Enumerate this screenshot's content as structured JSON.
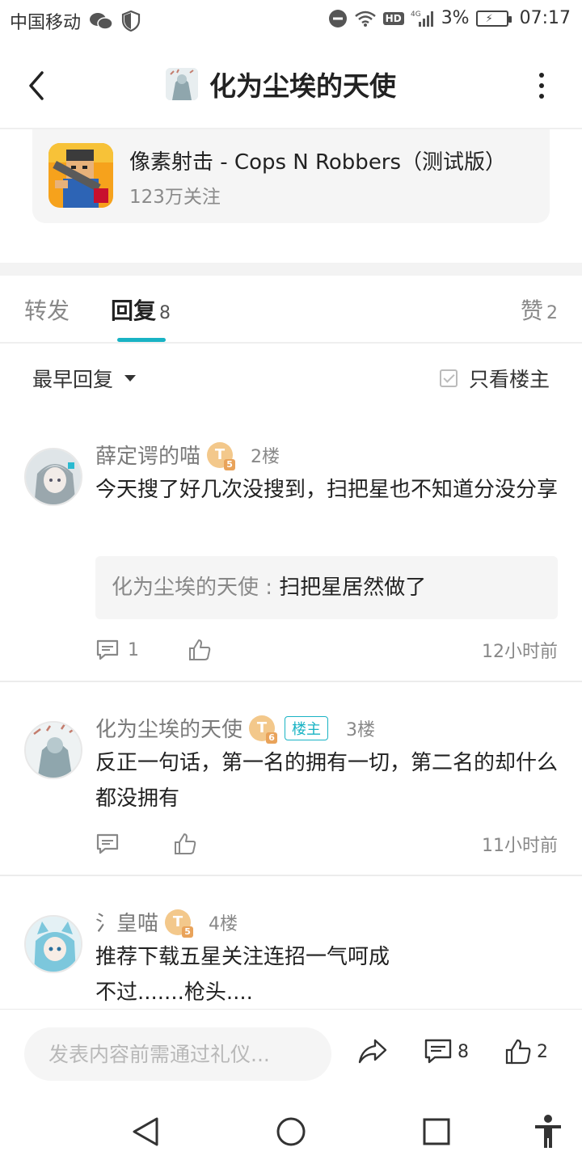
{
  "status_bar": {
    "carrier": "中国移动",
    "network": "4G",
    "hd": "HD",
    "battery": "3%",
    "time": "07:17"
  },
  "header": {
    "title": "化为尘埃的天使"
  },
  "game_card": {
    "name": "像素射击 - Cops N Robbers（测试版）",
    "followers": "123万关注"
  },
  "tabs": [
    {
      "label": "转发",
      "count": ""
    },
    {
      "label": "回复",
      "count": "8"
    },
    {
      "label": "赞",
      "count": "2"
    }
  ],
  "filter": {
    "sort_label": "最早回复",
    "only_op_label": "只看楼主"
  },
  "comments": [
    {
      "name": "薛定谔的喵",
      "level": "T",
      "level_num": "5",
      "floor": "2楼",
      "text": "今天搜了好几次没搜到，扫把星也不知道分没分享",
      "quote_name": "化为尘埃的天使 : ",
      "quote_text": "扫把星居然做了",
      "reply_count": "1",
      "time": "12小时前"
    },
    {
      "name": "化为尘埃的天使",
      "level": "T",
      "level_num": "6",
      "badge": "楼主",
      "floor": "3楼",
      "text": "反正一句话，第一名的拥有一切，第二名的却什么都没拥有",
      "time": "11小时前"
    },
    {
      "name": "氵皇喵",
      "level": "T",
      "level_num": "5",
      "floor": "4楼",
      "text_line1": "推荐下载五星关注连招一气呵成",
      "text_line2": "不过.......枪头...."
    }
  ],
  "bottom_bar": {
    "input_placeholder": "发表内容前需通过礼仪...",
    "reply_count": "8",
    "like_count": "2"
  },
  "colors": {
    "accent": "#19b3c4",
    "badge": "#f3c88b"
  }
}
